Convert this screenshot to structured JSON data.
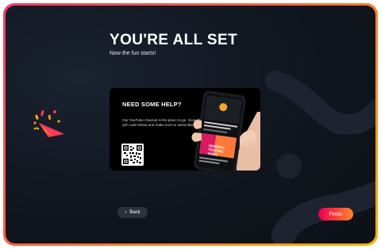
{
  "header": {
    "title": "YOU'RE ALL SET",
    "subtitle": "Now the fun starts!"
  },
  "help_card": {
    "heading": "NEED SOME HELP?",
    "body": "Our YouTube channel is the place to go. Scan the QR code below and make sure to subscribe!",
    "video_title": "GENERAL TRADING VIDEO"
  },
  "footer": {
    "back_label": "Back",
    "finish_label": "Finish"
  },
  "icons": {
    "celebration": "party-popper-icon",
    "back": "chevron-left-icon"
  },
  "colors": {
    "background": "#10151d",
    "frame_gradient_start": "#ff3b6b",
    "frame_gradient_end": "#ffb000",
    "finish_start": "#e60050",
    "finish_end": "#ff8a2a",
    "back_button": "#2b323d"
  }
}
